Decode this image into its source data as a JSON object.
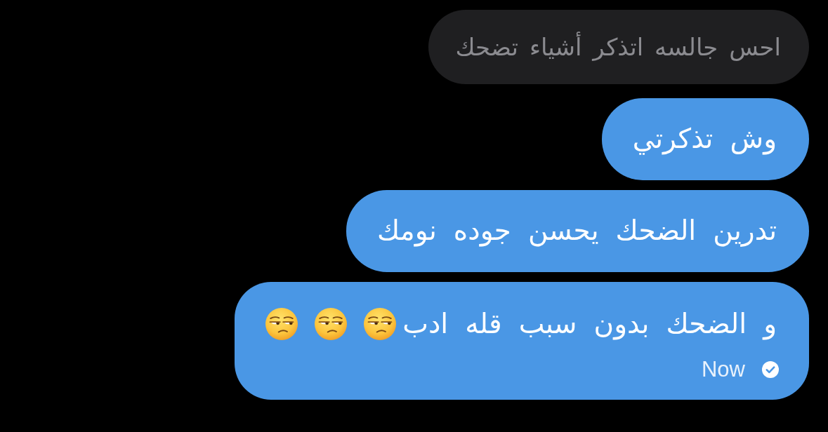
{
  "messages": [
    {
      "kind": "received",
      "text": "احس جالسه اتذكر أشياء تضحك"
    },
    {
      "kind": "sent",
      "text": "وش تذكرتي"
    },
    {
      "kind": "sent",
      "text": "تدرين الضحك يحسن جوده نومك"
    },
    {
      "kind": "sent",
      "text": "و الضحك بدون سبب قله ادب",
      "emojis": [
        {
          "kind": "unamused"
        },
        {
          "kind": "unamused"
        },
        {
          "kind": "unamused"
        }
      ],
      "time": "Now",
      "delivered": true
    }
  ]
}
